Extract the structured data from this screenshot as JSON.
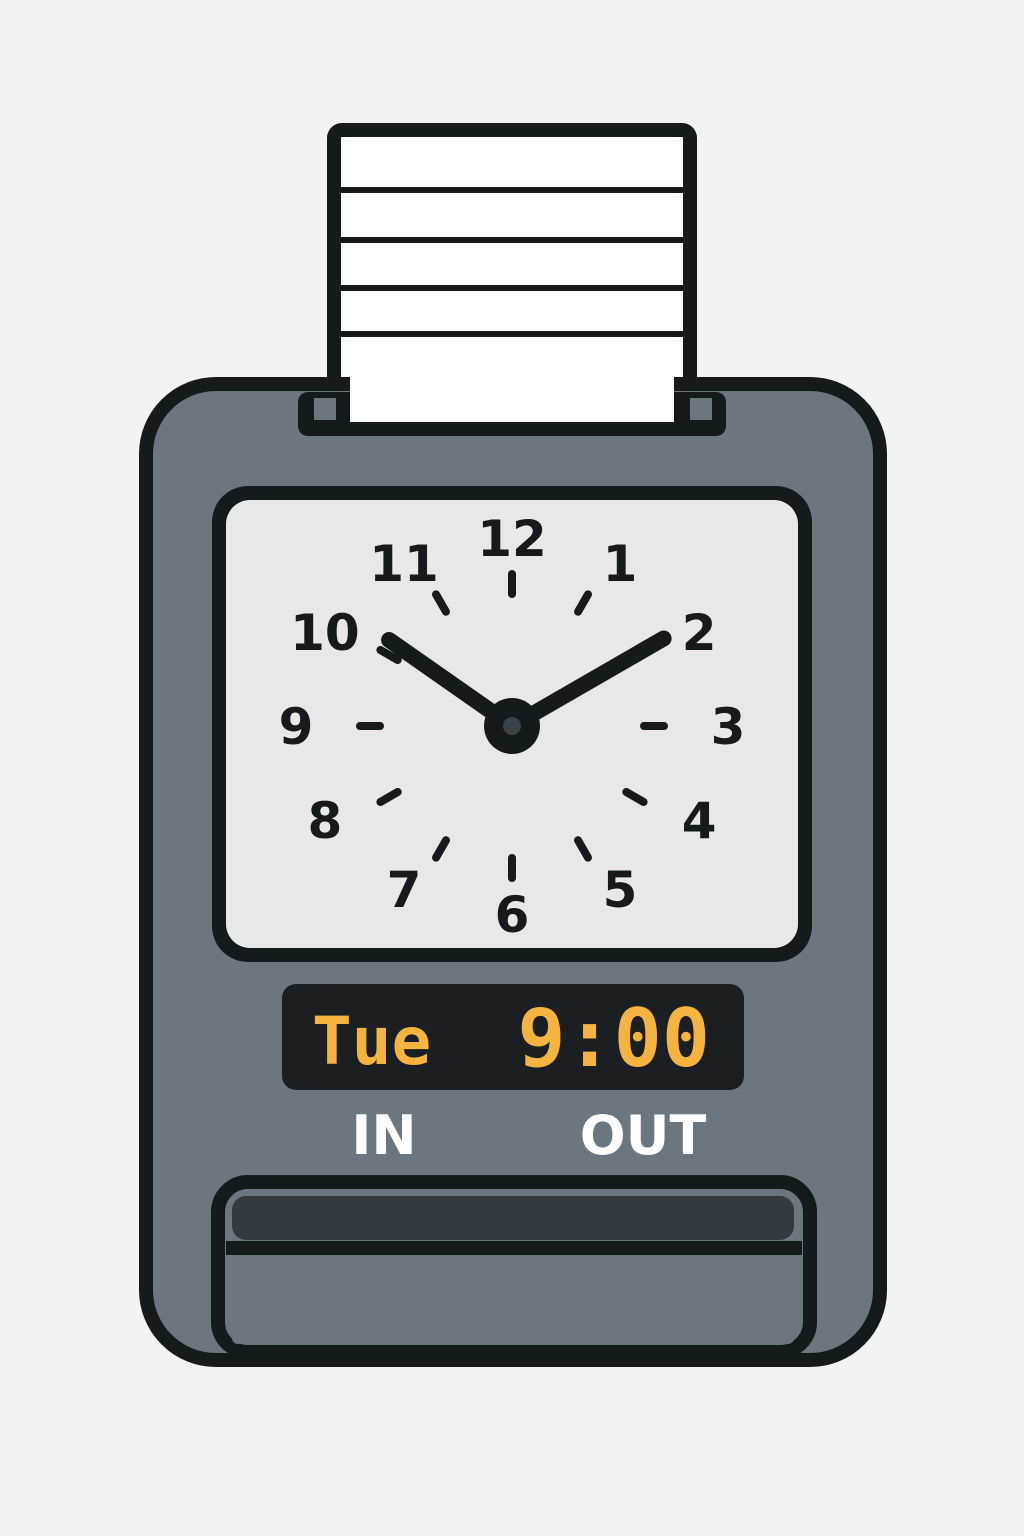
{
  "display": {
    "day": "Tue",
    "time": "9:00"
  },
  "labels": {
    "in": "IN",
    "out": "OUT"
  },
  "clock": {
    "numerals": [
      "12",
      "1",
      "2",
      "3",
      "4",
      "5",
      "6",
      "7",
      "8",
      "9",
      "10",
      "11"
    ],
    "hour": 10,
    "minute": 10
  },
  "colors": {
    "body": "#6c767e",
    "outline": "#151a1d",
    "face": "#e8e8e8",
    "lcd_background": "#1b1f22",
    "lcd_digits": "#f4b43f",
    "background": "#f3f3f3",
    "slot_dark": "#343a3e"
  }
}
